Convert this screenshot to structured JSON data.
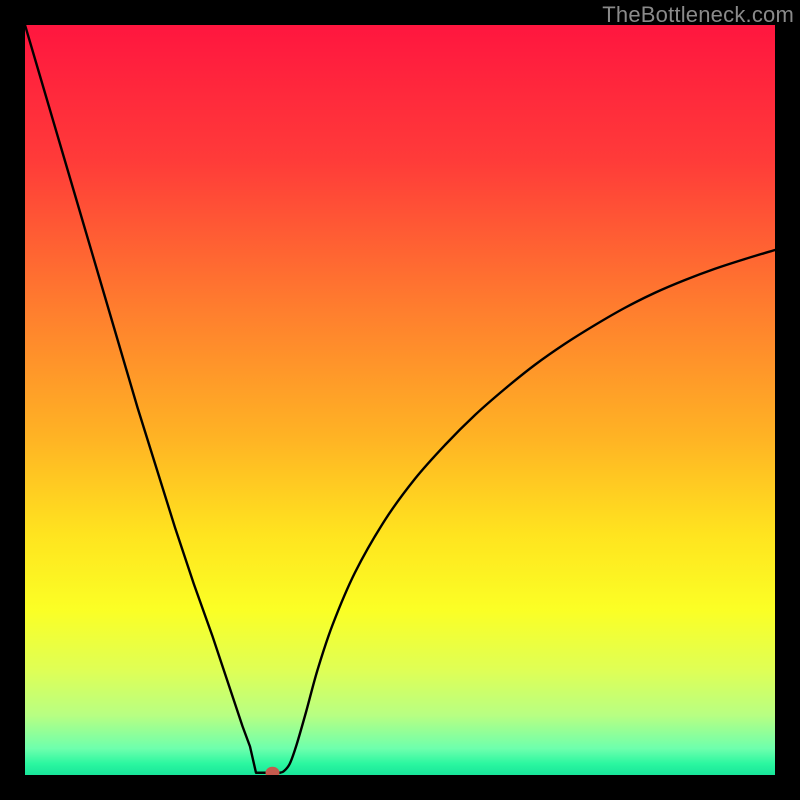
{
  "watermark": "TheBottleneck.com",
  "chart_data": {
    "type": "line",
    "title": "",
    "xlabel": "",
    "ylabel": "",
    "xlim": [
      0,
      100
    ],
    "ylim": [
      0,
      100
    ],
    "gradient_stops": [
      {
        "offset": 0.0,
        "color": "#ff163f"
      },
      {
        "offset": 0.18,
        "color": "#ff3b39"
      },
      {
        "offset": 0.38,
        "color": "#ff7e2e"
      },
      {
        "offset": 0.55,
        "color": "#ffb324"
      },
      {
        "offset": 0.68,
        "color": "#ffe41f"
      },
      {
        "offset": 0.78,
        "color": "#fbff25"
      },
      {
        "offset": 0.86,
        "color": "#dfff55"
      },
      {
        "offset": 0.92,
        "color": "#b8ff82"
      },
      {
        "offset": 0.965,
        "color": "#6dffad"
      },
      {
        "offset": 0.985,
        "color": "#2bf7a0"
      },
      {
        "offset": 1.0,
        "color": "#18e59a"
      }
    ],
    "series": [
      {
        "name": "bottleneck-curve",
        "x": [
          0.0,
          2.5,
          5.0,
          7.5,
          10.0,
          12.5,
          15.0,
          17.5,
          20.0,
          22.5,
          25.0,
          26.5,
          28.0,
          29.0,
          30.0,
          31.0,
          32.0,
          33.0,
          33.8,
          34.5,
          35.3,
          36.2,
          37.5,
          39.0,
          41.0,
          44.0,
          48.0,
          52.0,
          56.0,
          60.0,
          64.0,
          68.0,
          72.0,
          76.0,
          80.0,
          84.0,
          88.0,
          92.0,
          96.0,
          100.0
        ],
        "y": [
          100.0,
          91.5,
          83.0,
          74.5,
          66.0,
          57.5,
          49.0,
          41.0,
          33.0,
          25.5,
          18.5,
          14.0,
          9.5,
          6.5,
          3.8,
          1.8,
          0.7,
          0.3,
          0.3,
          0.5,
          1.5,
          4.0,
          8.5,
          14.0,
          20.0,
          27.0,
          34.0,
          39.5,
          44.0,
          48.0,
          51.5,
          54.7,
          57.5,
          60.0,
          62.3,
          64.3,
          66.0,
          67.5,
          68.8,
          70.0
        ]
      }
    ],
    "marker": {
      "x": 33.0,
      "y": 0.3,
      "color": "#c45a4d",
      "radius": 7
    },
    "flat_segment": {
      "x1": 30.8,
      "x2": 34.0,
      "y": 0.3
    }
  }
}
